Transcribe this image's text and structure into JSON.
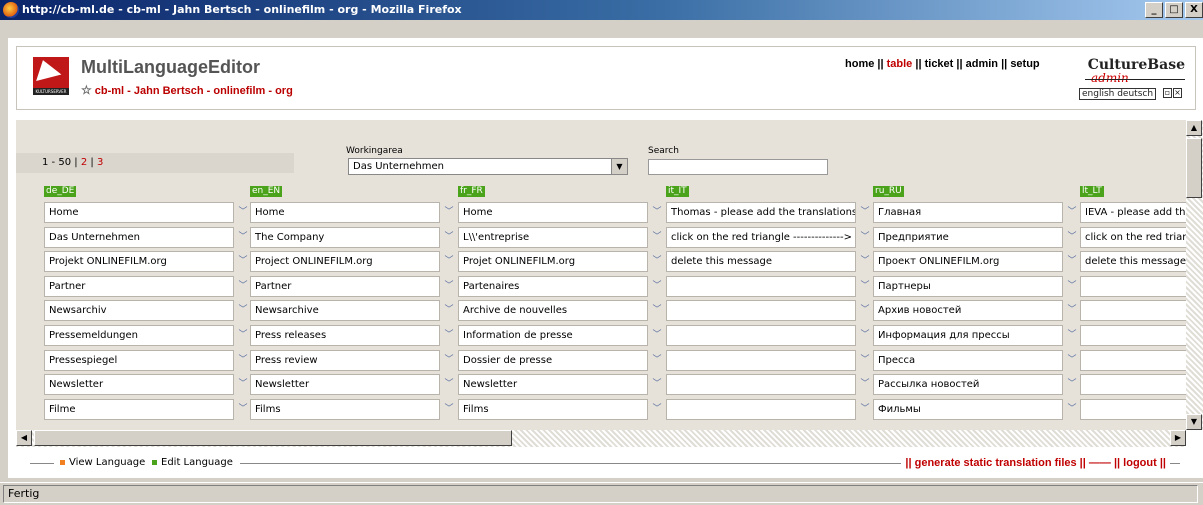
{
  "window": {
    "title": "http://cb-ml.de - cb-ml - Jahn Bertsch - onlinefilm - org - Mozilla Firefox",
    "buttons": [
      "_",
      "□",
      "X"
    ]
  },
  "header": {
    "app_title": "MultiLanguageEditor",
    "subtitle": "cb-ml - Jahn Bertsch - onlinefilm - org",
    "logo_strip": "KULTURSERVER",
    "nav": [
      {
        "label": "home",
        "active": false
      },
      {
        "label": "table",
        "active": true
      },
      {
        "label": "ticket",
        "active": false
      },
      {
        "label": "admin",
        "active": false
      },
      {
        "label": "setup",
        "active": false
      }
    ],
    "nav_separator": "||",
    "brand": {
      "word": "CultureBase",
      "admin": "admin",
      "lang_links": "english deutsch"
    }
  },
  "toolbar": {
    "pager": {
      "range": "1 - 50",
      "sep": "|",
      "pages": [
        "2",
        "3"
      ]
    },
    "workingarea_label": "Workingarea",
    "workingarea_value": "Das Unternehmen",
    "search_label": "Search",
    "search_value": ""
  },
  "table": {
    "columns": [
      "de_DE",
      "en_EN",
      "fr_FR",
      "it_IT",
      "ru_RU",
      "lt_LT"
    ],
    "rows": [
      [
        "Home",
        "Home",
        "Home",
        "Thomas - please add the translations h",
        "Главная",
        "IEVA - please add the"
      ],
      [
        "Das Unternehmen",
        "The Company",
        "L\\\\'entreprise",
        "click on the red triangle -------------->",
        "Предприятие",
        "click on the red triangle"
      ],
      [
        "Projekt ONLINEFILM.org",
        "Project ONLINEFILM.org",
        "Projet ONLINEFILM.org",
        "delete this message",
        "Проект ONLINEFILM.org",
        "delete this message...."
      ],
      [
        "Partner",
        "Partner",
        "Partenaires",
        "",
        "Партнеры",
        ""
      ],
      [
        "Newsarchiv",
        "Newsarchive",
        "Archive de nouvelles",
        "",
        "Архив новостей",
        ""
      ],
      [
        "Pressemeldungen",
        "Press releases",
        "Information de presse",
        "",
        "Информация для прессы",
        ""
      ],
      [
        "Pressespiegel",
        "Press review",
        "Dossier de presse",
        "",
        "Пресса",
        ""
      ],
      [
        "Newsletter",
        "Newsletter",
        "Newsletter",
        "",
        "Рассылка новостей",
        ""
      ],
      [
        "Filme",
        "Films",
        "Films",
        "",
        "Фильмы",
        ""
      ]
    ]
  },
  "footer": {
    "legend": [
      {
        "label": "View Language",
        "color": "#f08020"
      },
      {
        "label": "Edit Language",
        "color": "#4aa31a"
      }
    ],
    "links": [
      "generate static translation files",
      "logout"
    ]
  },
  "status": {
    "text": "Fertig"
  },
  "colors": {
    "accent_red": "#c00000",
    "green": "#4aa31a",
    "titlebar": "#0a246a"
  }
}
